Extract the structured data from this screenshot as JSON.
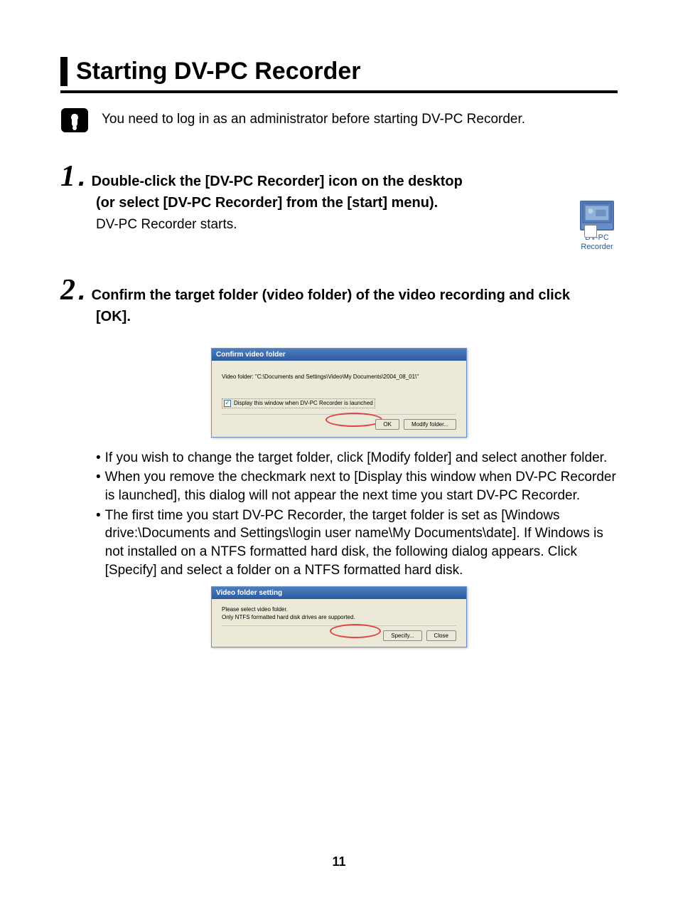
{
  "title": "Starting DV-PC Recorder",
  "caution": "You need to log in as an administrator before starting DV-PC Recorder.",
  "step1": {
    "number": "1",
    "line1": "Double-click the [DV-PC Recorder] icon on the desktop",
    "line2": "(or select [DV-PC Recorder] from the [start] menu).",
    "sub": "DV-PC Recorder starts."
  },
  "desktop_icon_label": "DV-PC Recorder",
  "step2": {
    "number": "2",
    "line1": "Confirm the target folder (video folder) of the video recording and click",
    "line2": "[OK]."
  },
  "dialog1": {
    "title": "Confirm video folder",
    "body": "Video folder: \"C:\\Documents and Settings\\Video\\My Documents\\2004_08_01\\\"",
    "checkbox": "Display this window when DV-PC Recorder is launched",
    "ok": "OK",
    "modify": "Modify folder..."
  },
  "bullets": {
    "b1": "If you wish to change the target folder, click [Modify folder] and select another folder.",
    "b2": "When you remove the checkmark next to [Display this window when DV-PC Recorder is launched], this dialog will not appear the next time you start DV-PC Recorder.",
    "b3": "The first time you start DV-PC Recorder, the target folder is set as [Windows drive:\\Documents and Settings\\login user name\\My Documents\\date]. If Windows is not installed on a NTFS formatted hard disk, the following dialog appears. Click [Specify] and select a folder on a NTFS formatted hard disk."
  },
  "dialog2": {
    "title": "Video folder setting",
    "line1": "Please select video folder.",
    "line2": "Only NTFS formatted hard disk drives are supported.",
    "specify": "Specify...",
    "close": "Close"
  },
  "page_number": "11"
}
